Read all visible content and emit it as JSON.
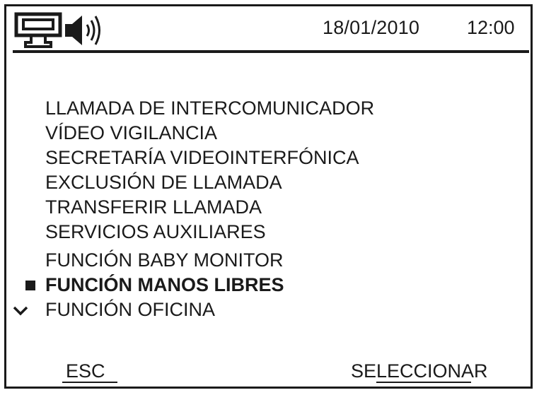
{
  "header": {
    "status_icons": [
      "intercom-icon",
      "speaker-icon"
    ],
    "date": "18/01/2010",
    "time": "12:00"
  },
  "menu": {
    "items": [
      {
        "label": "LLAMADA DE INTERCOMUNICADOR"
      },
      {
        "label": "VÍDEO VIGILANCIA"
      },
      {
        "label": "SECRETARÍA VIDEOINTERFÓNICA"
      },
      {
        "label": "EXCLUSIÓN DE LLAMADA"
      },
      {
        "label": "TRANSFERIR LLAMADA"
      },
      {
        "label": "SERVICIOS AUXILIARES"
      },
      {
        "label": "FUNCIÓN BABY MONITOR"
      },
      {
        "label": "FUNCIÓN MANOS LIBRES",
        "selected": true
      },
      {
        "label": "FUNCIÓN OFICINA"
      }
    ],
    "more_below_icon": "chevron-down-icon",
    "selection_marker_icon": "square-bullet-icon"
  },
  "softkeys": {
    "left": "ESC",
    "right": "SELECCIONAR"
  },
  "colors": {
    "foreground": "#1a1a1a",
    "background": "#ffffff"
  }
}
